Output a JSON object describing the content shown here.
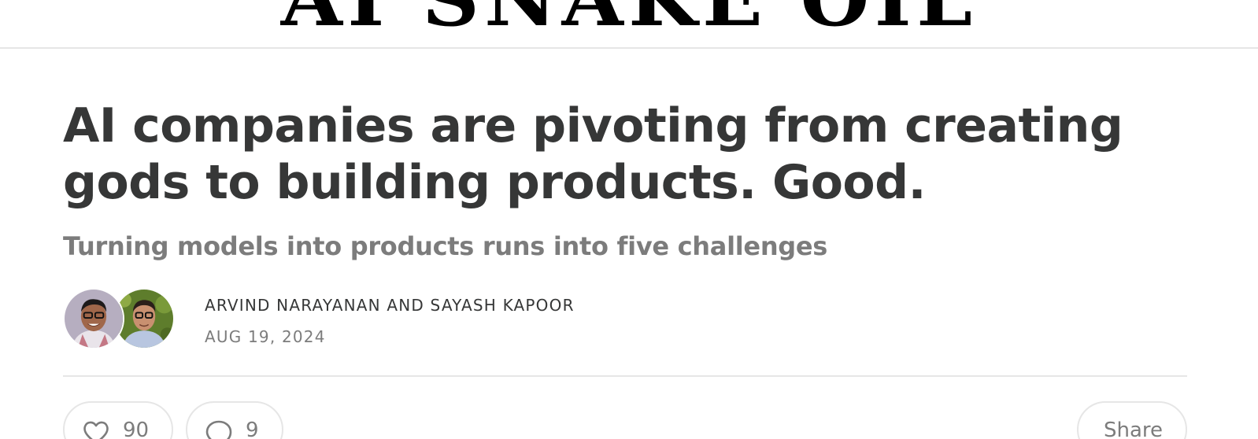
{
  "masthead": {
    "title": "AI SNAKE OIL"
  },
  "post": {
    "title": "AI companies are pivoting from creating gods to building products. Good.",
    "subtitle": "Turning models into products runs into five challenges",
    "authors": "Arvind Narayanan and Sayash Kapoor",
    "date": "Aug 19, 2024"
  },
  "actions": {
    "like_count": "90",
    "comment_count": "9",
    "share_label": "Share"
  },
  "icons": {
    "like": "heart-icon",
    "comment": "comment-bubble-icon"
  },
  "colors": {
    "title": "#363737",
    "muted": "#7c7c7c",
    "divider": "#e6e6e6"
  }
}
